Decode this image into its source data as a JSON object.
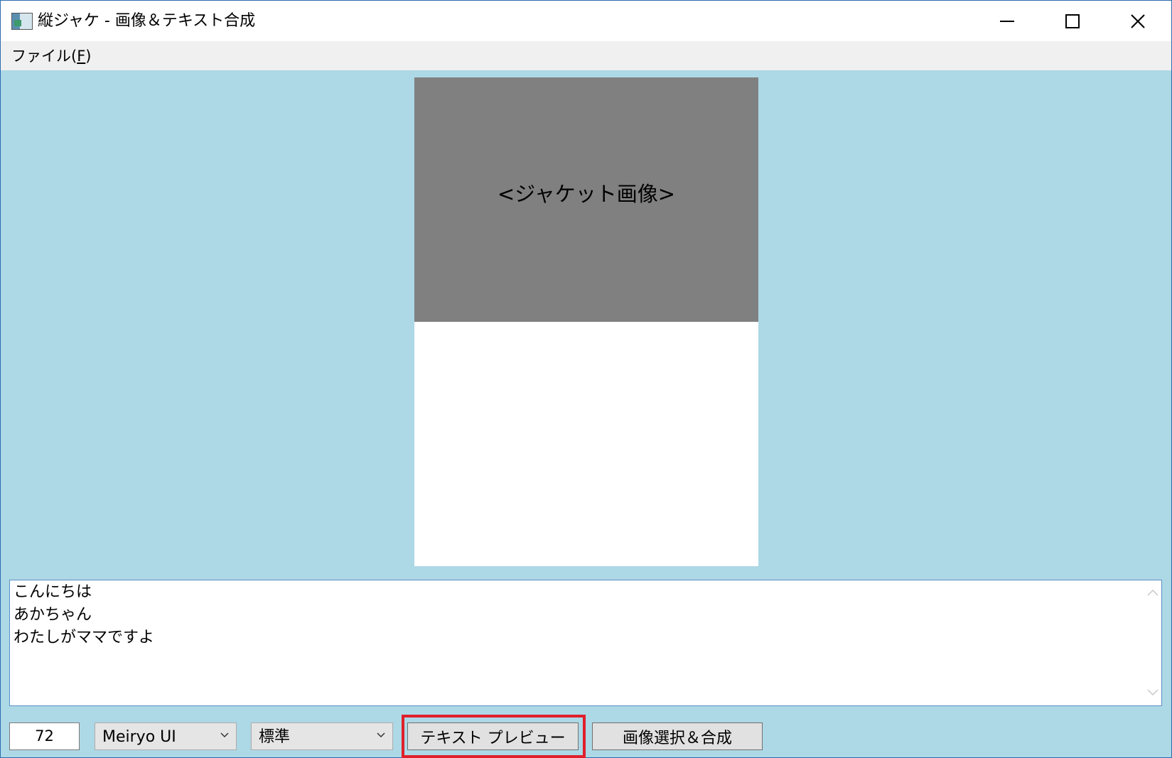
{
  "window": {
    "title": "縦ジャケ - 画像＆テキスト合成",
    "icon": "app-icon"
  },
  "menu": {
    "file_label_prefix": "ファイル(",
    "file_label_accel": "F",
    "file_label_suffix": ")"
  },
  "jacket": {
    "image_placeholder": "<ジャケット画像>"
  },
  "editor": {
    "lines": [
      "こんにちは",
      "あかちゃん",
      "わたしがママですよ"
    ]
  },
  "toolbar": {
    "font_size": "72",
    "font_family": "Meiryo UI",
    "font_style": "標準",
    "preview_label": "テキスト プレビュー",
    "compose_label": "画像選択＆合成"
  },
  "colors": {
    "client_background": "#add8e6",
    "jacket_image": "#808080",
    "highlight": "#e0202a"
  }
}
